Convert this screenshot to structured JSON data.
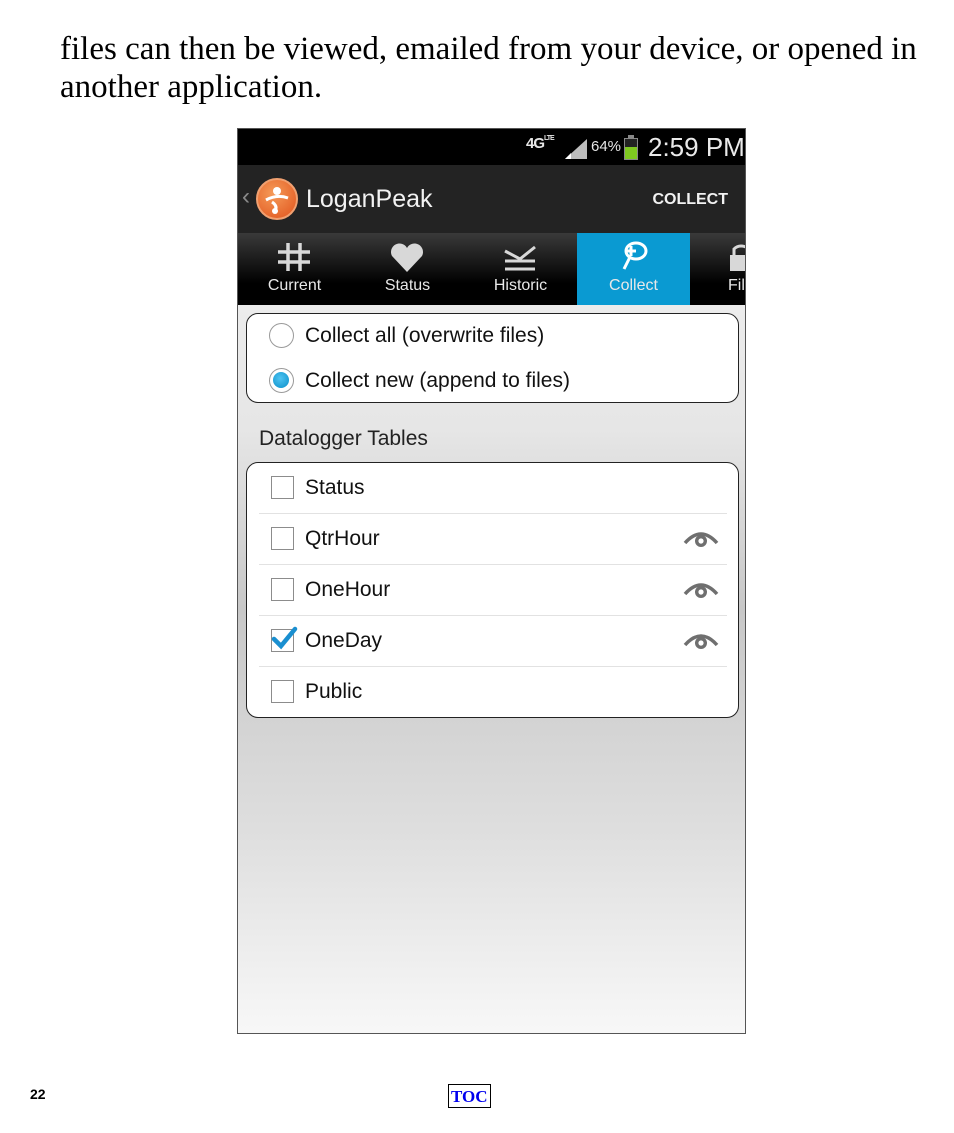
{
  "document": {
    "intro_line1": "files can then be viewed, emailed from your device, or opened in",
    "intro_line2": "another application.",
    "page_number": "22",
    "toc_link": "TOC"
  },
  "statusbar": {
    "network": "4G",
    "network_suffix": "LTE",
    "battery": "64%",
    "time": "2:59 PM"
  },
  "actionbar": {
    "title": "LoganPeak",
    "action": "COLLECT"
  },
  "tabs": [
    {
      "label": "Current",
      "icon": "hash-icon"
    },
    {
      "label": "Status",
      "icon": "heart-icon"
    },
    {
      "label": "Historic",
      "icon": "historic-icon"
    },
    {
      "label": "Collect",
      "icon": "collect-net-icon",
      "active": true
    },
    {
      "label": "Fil",
      "icon": "files-icon"
    }
  ],
  "collect_mode": {
    "options": [
      {
        "label": "Collect all (overwrite files)",
        "selected": false
      },
      {
        "label": "Collect new (append to files)",
        "selected": true
      }
    ]
  },
  "tables": {
    "heading": "Datalogger Tables",
    "items": [
      {
        "label": "Status",
        "checked": false,
        "viewable": false
      },
      {
        "label": "QtrHour",
        "checked": false,
        "viewable": true
      },
      {
        "label": "OneHour",
        "checked": false,
        "viewable": true
      },
      {
        "label": "OneDay",
        "checked": true,
        "viewable": true
      },
      {
        "label": "Public",
        "checked": false,
        "viewable": false
      }
    ]
  },
  "colors": {
    "accent": "#0a9ad2",
    "logo": "#e0531c",
    "actionbar": "#232323"
  }
}
